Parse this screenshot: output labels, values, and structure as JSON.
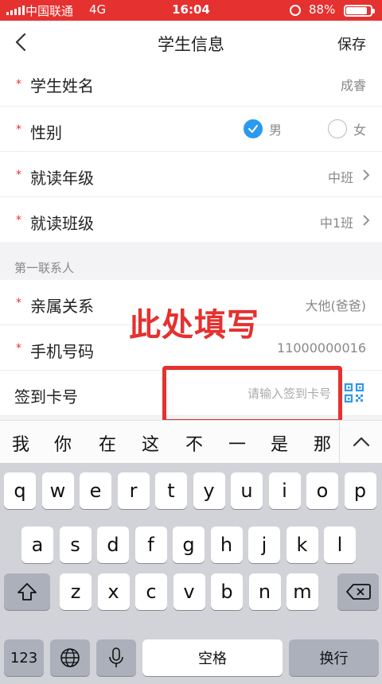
{
  "status_bar": {
    "carrier": "中国联通",
    "network": "4G",
    "time": "16:04",
    "battery_percent": "88%",
    "battery_level": 0.88,
    "icons": [
      "signal-icon",
      "orientation-lock-icon",
      "battery-icon"
    ]
  },
  "nav": {
    "back_icon": "chevron-left-icon",
    "title": "学生信息",
    "save_label": "保存"
  },
  "student": {
    "name_label": "学生姓名",
    "name_value": "成睿",
    "gender_label": "性别",
    "gender_options": [
      {
        "label": "男",
        "selected": true
      },
      {
        "label": "女",
        "selected": false
      }
    ],
    "grade_label": "就读年级",
    "grade_value": "中班",
    "class_label": "就读班级",
    "class_value": "中1班"
  },
  "contact": {
    "section_title": "第一联系人",
    "relation_label": "亲属关系",
    "relation_value": "大他(爸爸)",
    "phone_label": "手机号码",
    "phone_value": "11000000016",
    "card_label": "签到卡号",
    "card_placeholder": "请输入签到卡号",
    "card_value": ""
  },
  "annotation": {
    "text": "此处填写",
    "color": "#e5312f"
  },
  "candidates": {
    "words": [
      "我",
      "你",
      "在",
      "这",
      "不",
      "一",
      "是",
      "那"
    ],
    "collapse_icon": "chevron-up-icon"
  },
  "keyboard": {
    "row1": [
      "q",
      "w",
      "e",
      "r",
      "t",
      "y",
      "u",
      "i",
      "o",
      "p"
    ],
    "row2": [
      "a",
      "s",
      "d",
      "f",
      "g",
      "h",
      "j",
      "k",
      "l"
    ],
    "row3": [
      "z",
      "x",
      "c",
      "v",
      "b",
      "n",
      "m"
    ],
    "numbers_label": "123",
    "space_label": "空格",
    "return_label": "换行",
    "icons": [
      "shift-icon",
      "backspace-icon",
      "globe-icon",
      "microphone-icon"
    ]
  },
  "colors": {
    "status_bar": "#e5312f",
    "required_star": "#e5312f",
    "accent": "#2b9aee",
    "qr_icon": "#2b9aee"
  }
}
